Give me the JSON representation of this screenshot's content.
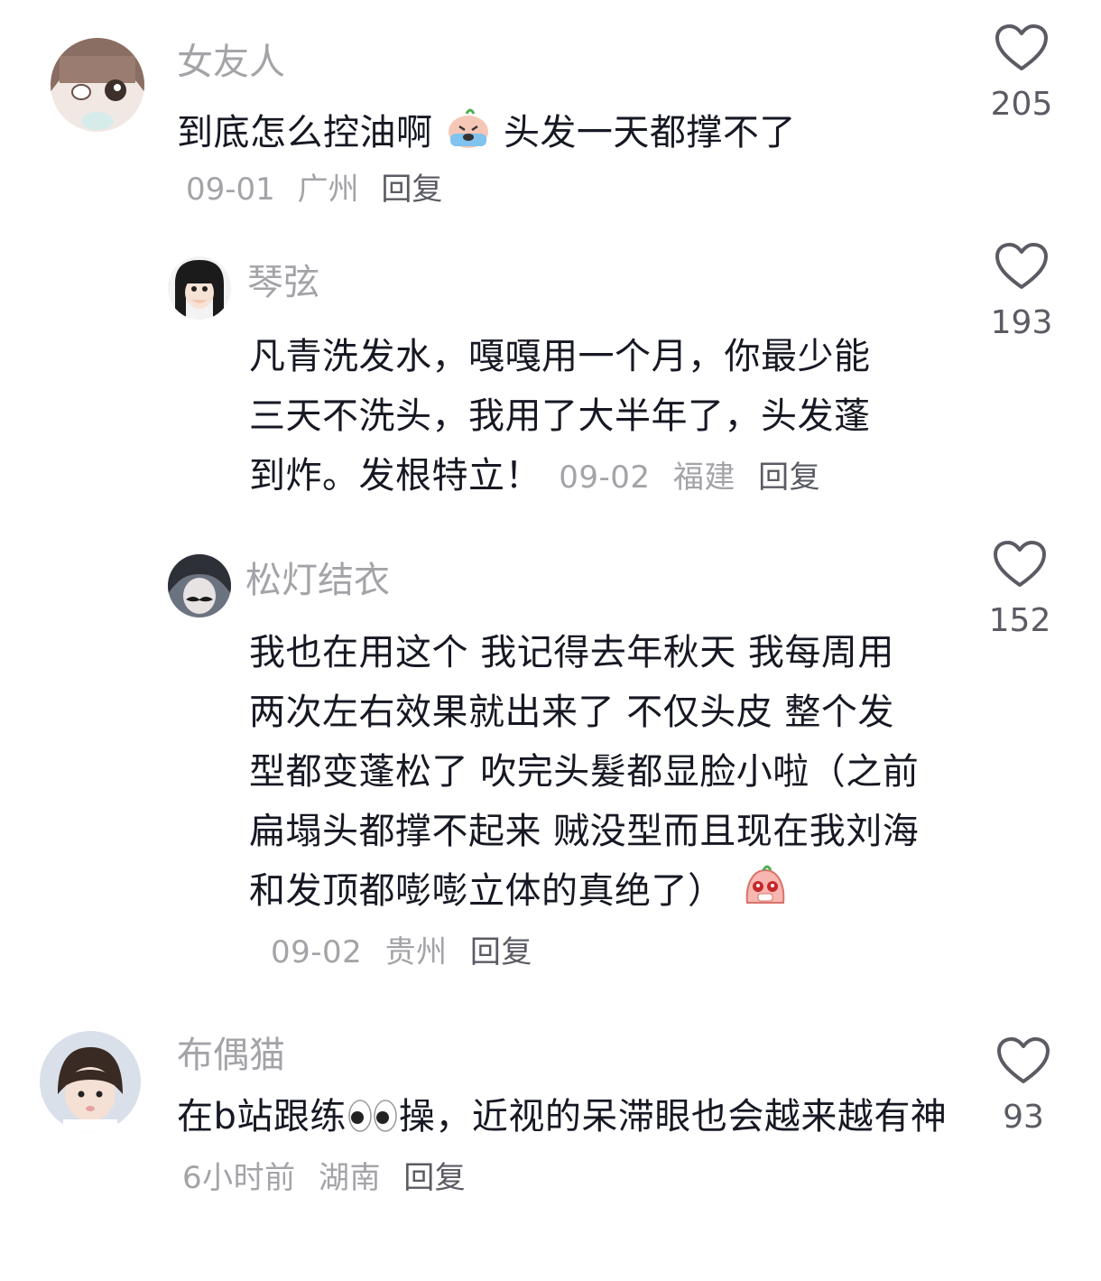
{
  "comments": [
    {
      "username": "女友人",
      "text_before_emoji": "到底怎么控油啊",
      "emoji": "crying-face-emoji",
      "text_after_emoji": "头发一天都撑不了",
      "date": "09-01",
      "location": "广州",
      "reply_label": "回复",
      "likes": "205"
    },
    {
      "username": "琴弦",
      "text": "凡青洗发水，嘎嘎用一个月，你最少能三天不洗头，我用了大半年了，头发蓬到炸。发根特立！",
      "date": "09-02",
      "location": "福建",
      "reply_label": "回复",
      "likes": "193"
    },
    {
      "username": "松灯结衣",
      "text": "我也在用这个 我记得去年秋天 我每周用两次左右效果就出来了 不仅头皮 整个发型都变蓬松了 吹完头髮都显脸小啦（之前扁塌头都撑不起来 贼没型而且现在我刘海和发顶都嘭嘭立体的真绝了）",
      "emoji": "pleading-face-emoji",
      "date": "09-02",
      "location": "贵州",
      "reply_label": "回复",
      "likes": "152"
    },
    {
      "username": "布偶猫",
      "text_before_emoji": "在b站跟练",
      "emoji": "eyes-emoji",
      "text_after_emoji": "操，近视的呆滞眼也会越来越有神",
      "date": "6小时前",
      "location": "湖南",
      "reply_label": "回复",
      "likes": "93"
    }
  ]
}
